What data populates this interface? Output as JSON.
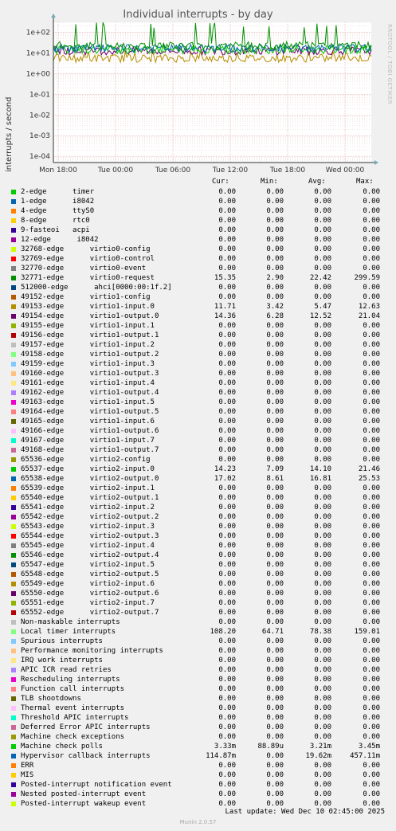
{
  "chart_data": {
    "type": "line",
    "title": "Individual interrupts - by day",
    "ylabel": "interrupts / second",
    "yscale": "log",
    "ylim": [
      5e-05,
      300
    ],
    "y_ticks": [
      "1e+02",
      "1e+01",
      "1e+00",
      "1e-01",
      "1e-02",
      "1e-03",
      "1e-04"
    ],
    "x_ticks": [
      "Mon 18:00",
      "Tue 00:00",
      "Tue 06:00",
      "Tue 12:00",
      "Tue 18:00",
      "Wed 00:00"
    ],
    "grid": true,
    "watermark": "RRDTOOL / TOBI OETIKER",
    "columns": [
      "Cur:",
      "Min:",
      "Avg:",
      "Max:"
    ],
    "series": [
      {
        "name": "2-edge      timer",
        "color": "#00cc00",
        "cur": "0.00",
        "min": "0.00",
        "avg": "0.00",
        "max": "0.00"
      },
      {
        "name": "1-edge      i8042",
        "color": "#0066b3",
        "cur": "0.00",
        "min": "0.00",
        "avg": "0.00",
        "max": "0.00"
      },
      {
        "name": "4-edge      ttyS0",
        "color": "#ff8000",
        "cur": "0.00",
        "min": "0.00",
        "avg": "0.00",
        "max": "0.00"
      },
      {
        "name": "8-edge      rtc0",
        "color": "#ffcc00",
        "cur": "0.00",
        "min": "0.00",
        "avg": "0.00",
        "max": "0.00"
      },
      {
        "name": "9-fasteoi   acpi",
        "color": "#330099",
        "cur": "0.00",
        "min": "0.00",
        "avg": "0.00",
        "max": "0.00"
      },
      {
        "name": "12-edge      i8042",
        "color": "#990099",
        "cur": "0.00",
        "min": "0.00",
        "avg": "0.00",
        "max": "0.00"
      },
      {
        "name": "32768-edge      virtio0-config",
        "color": "#ccff00",
        "cur": "0.00",
        "min": "0.00",
        "avg": "0.00",
        "max": "0.00"
      },
      {
        "name": "32769-edge      virtio0-control",
        "color": "#ff0000",
        "cur": "0.00",
        "min": "0.00",
        "avg": "0.00",
        "max": "0.00"
      },
      {
        "name": "32770-edge      virtio0-event",
        "color": "#808080",
        "cur": "0.00",
        "min": "0.00",
        "avg": "0.00",
        "max": "0.00"
      },
      {
        "name": "32771-edge      virtio0-request",
        "color": "#008f00",
        "cur": "15.35",
        "min": "2.90",
        "avg": "22.42",
        "max": "299.59"
      },
      {
        "name": "512000-edge      ahci[0000:00:1f.2]",
        "color": "#00487d",
        "cur": "0.00",
        "min": "0.00",
        "avg": "0.00",
        "max": "0.00"
      },
      {
        "name": "49152-edge      virtio1-config",
        "color": "#b35a00",
        "cur": "0.00",
        "min": "0.00",
        "avg": "0.00",
        "max": "0.00"
      },
      {
        "name": "49153-edge      virtio1-input.0",
        "color": "#b38f00",
        "cur": "11.71",
        "min": "3.42",
        "avg": "5.47",
        "max": "12.63"
      },
      {
        "name": "49154-edge      virtio1-output.0",
        "color": "#6b006b",
        "cur": "14.36",
        "min": "6.28",
        "avg": "12.52",
        "max": "21.04"
      },
      {
        "name": "49155-edge      virtio1-input.1",
        "color": "#8fb300",
        "cur": "0.00",
        "min": "0.00",
        "avg": "0.00",
        "max": "0.00"
      },
      {
        "name": "49156-edge      virtio1-output.1",
        "color": "#b30000",
        "cur": "0.00",
        "min": "0.00",
        "avg": "0.00",
        "max": "0.00"
      },
      {
        "name": "49157-edge      virtio1-input.2",
        "color": "#bebebe",
        "cur": "0.00",
        "min": "0.00",
        "avg": "0.00",
        "max": "0.00"
      },
      {
        "name": "49158-edge      virtio1-output.2",
        "color": "#80ff80",
        "cur": "0.00",
        "min": "0.00",
        "avg": "0.00",
        "max": "0.00"
      },
      {
        "name": "49159-edge      virtio1-input.3",
        "color": "#80c9ff",
        "cur": "0.00",
        "min": "0.00",
        "avg": "0.00",
        "max": "0.00"
      },
      {
        "name": "49160-edge      virtio1-output.3",
        "color": "#ffc080",
        "cur": "0.00",
        "min": "0.00",
        "avg": "0.00",
        "max": "0.00"
      },
      {
        "name": "49161-edge      virtio1-input.4",
        "color": "#ffe680",
        "cur": "0.00",
        "min": "0.00",
        "avg": "0.00",
        "max": "0.00"
      },
      {
        "name": "49162-edge      virtio1-output.4",
        "color": "#aa80ff",
        "cur": "0.00",
        "min": "0.00",
        "avg": "0.00",
        "max": "0.00"
      },
      {
        "name": "49163-edge      virtio1-input.5",
        "color": "#ee00cc",
        "cur": "0.00",
        "min": "0.00",
        "avg": "0.00",
        "max": "0.00"
      },
      {
        "name": "49164-edge      virtio1-output.5",
        "color": "#ff8080",
        "cur": "0.00",
        "min": "0.00",
        "avg": "0.00",
        "max": "0.00"
      },
      {
        "name": "49165-edge      virtio1-input.6",
        "color": "#666600",
        "cur": "0.00",
        "min": "0.00",
        "avg": "0.00",
        "max": "0.00"
      },
      {
        "name": "49166-edge      virtio1-output.6",
        "color": "#ffbfff",
        "cur": "0.00",
        "min": "0.00",
        "avg": "0.00",
        "max": "0.00"
      },
      {
        "name": "49167-edge      virtio1-input.7",
        "color": "#00ffcc",
        "cur": "0.00",
        "min": "0.00",
        "avg": "0.00",
        "max": "0.00"
      },
      {
        "name": "49168-edge      virtio1-output.7",
        "color": "#cc6699",
        "cur": "0.00",
        "min": "0.00",
        "avg": "0.00",
        "max": "0.00"
      },
      {
        "name": "65536-edge      virtio2-config",
        "color": "#999900",
        "cur": "0.00",
        "min": "0.00",
        "avg": "0.00",
        "max": "0.00"
      },
      {
        "name": "65537-edge      virtio2-input.0",
        "color": "#00cc00",
        "cur": "14.23",
        "min": "7.09",
        "avg": "14.10",
        "max": "21.46"
      },
      {
        "name": "65538-edge      virtio2-output.0",
        "color": "#0066b3",
        "cur": "17.02",
        "min": "8.61",
        "avg": "16.81",
        "max": "25.53"
      },
      {
        "name": "65539-edge      virtio2-input.1",
        "color": "#ff8000",
        "cur": "0.00",
        "min": "0.00",
        "avg": "0.00",
        "max": "0.00"
      },
      {
        "name": "65540-edge      virtio2-output.1",
        "color": "#ffcc00",
        "cur": "0.00",
        "min": "0.00",
        "avg": "0.00",
        "max": "0.00"
      },
      {
        "name": "65541-edge      virtio2-input.2",
        "color": "#330099",
        "cur": "0.00",
        "min": "0.00",
        "avg": "0.00",
        "max": "0.00"
      },
      {
        "name": "65542-edge      virtio2-output.2",
        "color": "#990099",
        "cur": "0.00",
        "min": "0.00",
        "avg": "0.00",
        "max": "0.00"
      },
      {
        "name": "65543-edge      virtio2-input.3",
        "color": "#ccff00",
        "cur": "0.00",
        "min": "0.00",
        "avg": "0.00",
        "max": "0.00"
      },
      {
        "name": "65544-edge      virtio2-output.3",
        "color": "#ff0000",
        "cur": "0.00",
        "min": "0.00",
        "avg": "0.00",
        "max": "0.00"
      },
      {
        "name": "65545-edge      virtio2-input.4",
        "color": "#808080",
        "cur": "0.00",
        "min": "0.00",
        "avg": "0.00",
        "max": "0.00"
      },
      {
        "name": "65546-edge      virtio2-output.4",
        "color": "#008f00",
        "cur": "0.00",
        "min": "0.00",
        "avg": "0.00",
        "max": "0.00"
      },
      {
        "name": "65547-edge      virtio2-input.5",
        "color": "#00487d",
        "cur": "0.00",
        "min": "0.00",
        "avg": "0.00",
        "max": "0.00"
      },
      {
        "name": "65548-edge      virtio2-output.5",
        "color": "#b35a00",
        "cur": "0.00",
        "min": "0.00",
        "avg": "0.00",
        "max": "0.00"
      },
      {
        "name": "65549-edge      virtio2-input.6",
        "color": "#b38f00",
        "cur": "0.00",
        "min": "0.00",
        "avg": "0.00",
        "max": "0.00"
      },
      {
        "name": "65550-edge      virtio2-output.6",
        "color": "#6b006b",
        "cur": "0.00",
        "min": "0.00",
        "avg": "0.00",
        "max": "0.00"
      },
      {
        "name": "65551-edge      virtio2-input.7",
        "color": "#8fb300",
        "cur": "0.00",
        "min": "0.00",
        "avg": "0.00",
        "max": "0.00"
      },
      {
        "name": "65552-edge      virtio2-output.7",
        "color": "#b30000",
        "cur": "0.00",
        "min": "0.00",
        "avg": "0.00",
        "max": "0.00"
      },
      {
        "name": "Non-maskable interrupts",
        "color": "#bebebe",
        "cur": "0.00",
        "min": "0.00",
        "avg": "0.00",
        "max": "0.00"
      },
      {
        "name": "Local timer interrupts",
        "color": "#80ff80",
        "cur": "108.20",
        "min": "64.71",
        "avg": "78.38",
        "max": "159.01"
      },
      {
        "name": "Spurious interrupts",
        "color": "#80c9ff",
        "cur": "0.00",
        "min": "0.00",
        "avg": "0.00",
        "max": "0.00"
      },
      {
        "name": "Performance monitoring interrupts",
        "color": "#ffc080",
        "cur": "0.00",
        "min": "0.00",
        "avg": "0.00",
        "max": "0.00"
      },
      {
        "name": "IRQ work interrupts",
        "color": "#ffe680",
        "cur": "0.00",
        "min": "0.00",
        "avg": "0.00",
        "max": "0.00"
      },
      {
        "name": "APIC ICR read retries",
        "color": "#aa80ff",
        "cur": "0.00",
        "min": "0.00",
        "avg": "0.00",
        "max": "0.00"
      },
      {
        "name": "Rescheduling interrupts",
        "color": "#ee00cc",
        "cur": "0.00",
        "min": "0.00",
        "avg": "0.00",
        "max": "0.00"
      },
      {
        "name": "Function call interrupts",
        "color": "#ff8080",
        "cur": "0.00",
        "min": "0.00",
        "avg": "0.00",
        "max": "0.00"
      },
      {
        "name": "TLB shootdowns",
        "color": "#666600",
        "cur": "0.00",
        "min": "0.00",
        "avg": "0.00",
        "max": "0.00"
      },
      {
        "name": "Thermal event interrupts",
        "color": "#ffbfff",
        "cur": "0.00",
        "min": "0.00",
        "avg": "0.00",
        "max": "0.00"
      },
      {
        "name": "Threshold APIC interrupts",
        "color": "#00ffcc",
        "cur": "0.00",
        "min": "0.00",
        "avg": "0.00",
        "max": "0.00"
      },
      {
        "name": "Deferred Error APIC interrupts",
        "color": "#cc6699",
        "cur": "0.00",
        "min": "0.00",
        "avg": "0.00",
        "max": "0.00"
      },
      {
        "name": "Machine check exceptions",
        "color": "#999900",
        "cur": "0.00",
        "min": "0.00",
        "avg": "0.00",
        "max": "0.00"
      },
      {
        "name": "Machine check polls",
        "color": "#00cc00",
        "cur": "3.33m",
        "min": "88.89u",
        "avg": "3.21m",
        "max": "3.45m"
      },
      {
        "name": "Hypervisor callback interrupts",
        "color": "#0066b3",
        "cur": "114.87m",
        "min": "0.00",
        "avg": "19.62m",
        "max": "457.11m"
      },
      {
        "name": "ERR",
        "color": "#ff8000",
        "cur": "0.00",
        "min": "0.00",
        "avg": "0.00",
        "max": "0.00"
      },
      {
        "name": "MIS",
        "color": "#ffcc00",
        "cur": "0.00",
        "min": "0.00",
        "avg": "0.00",
        "max": "0.00"
      },
      {
        "name": "Posted-interrupt notification event",
        "color": "#330099",
        "cur": "0.00",
        "min": "0.00",
        "avg": "0.00",
        "max": "0.00"
      },
      {
        "name": "Nested posted-interrupt event",
        "color": "#990099",
        "cur": "0.00",
        "min": "0.00",
        "avg": "0.00",
        "max": "0.00"
      },
      {
        "name": "Posted-interrupt wakeup event",
        "color": "#ccff00",
        "cur": "0.00",
        "min": "0.00",
        "avg": "0.00",
        "max": "0.00"
      }
    ]
  },
  "footer": {
    "last_update": "Last update: Wed Dec 10 02:45:00 2025",
    "munin_version": "Munin 2.0.57"
  }
}
